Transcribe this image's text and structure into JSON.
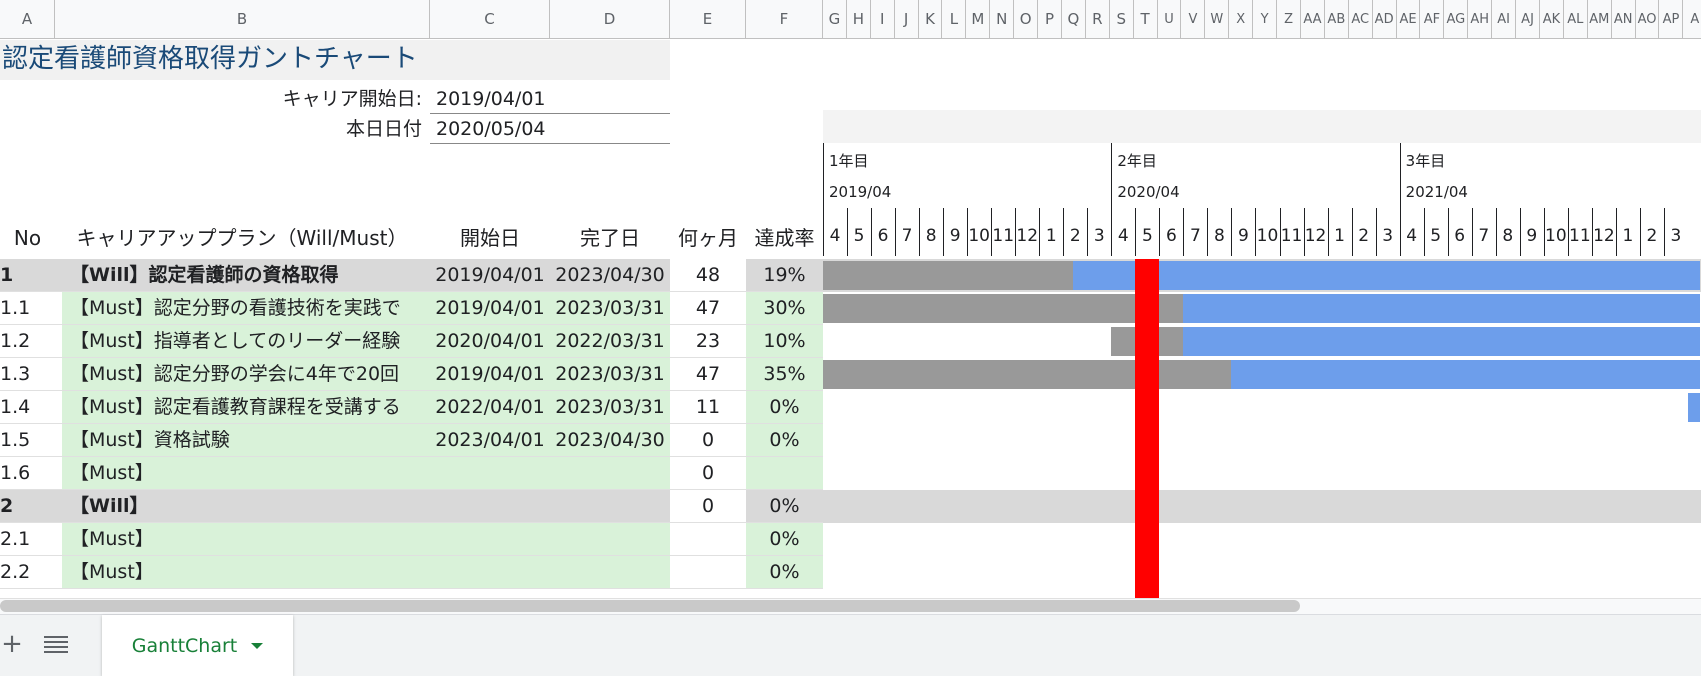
{
  "columns": [
    "A",
    "B",
    "C",
    "D",
    "E",
    "F",
    "G",
    "H",
    "I",
    "J",
    "K",
    "L",
    "M",
    "N",
    "O",
    "P",
    "Q",
    "R",
    "S",
    "T",
    "U",
    "V",
    "W",
    "X",
    "Y",
    "Z",
    "AA",
    "AB",
    "AC",
    "AD",
    "AE",
    "AF",
    "AG",
    "AH",
    "AI",
    "AJ",
    "AK",
    "AL",
    "AM",
    "AN",
    "AO",
    "AP",
    "A"
  ],
  "sheet_title": "認定看護師資格取得ガントチャート",
  "career_start": {
    "label": "キャリア開始日:",
    "value": "2019/04/01"
  },
  "today": {
    "label": "本日日付",
    "value": "2020/05/04"
  },
  "headers": {
    "no": "No",
    "plan": "キャリアアッププラン（Will/Must）",
    "start": "開始日",
    "end": "完了日",
    "months": "何ヶ月",
    "rate": "達成率"
  },
  "timeline": {
    "years": [
      {
        "label": "1年目",
        "month": "2019/04"
      },
      {
        "label": "2年目",
        "month": "2020/04"
      },
      {
        "label": "3年目",
        "month": "2021/04"
      }
    ],
    "months": [
      "4",
      "5",
      "6",
      "7",
      "8",
      "9",
      "10",
      "11",
      "12",
      "1",
      "2",
      "3",
      "4",
      "5",
      "6",
      "7",
      "8",
      "9",
      "10",
      "11",
      "12",
      "1",
      "2",
      "3",
      "4",
      "5",
      "6",
      "7",
      "8",
      "9",
      "10",
      "11",
      "12",
      "1",
      "2",
      "3"
    ],
    "today_month_index": 13
  },
  "rows": [
    {
      "no": "1",
      "plan": "【Will】認定看護師の資格取得",
      "start": "2019/04/01",
      "end": "2023/04/30",
      "months": "48",
      "rate": "19%",
      "type": "will",
      "bar_start": 0,
      "bar_done_end": 10.4
    },
    {
      "no": "1.1",
      "plan": "【Must】認定分野の看護技術を実践で",
      "start": "2019/04/01",
      "end": "2023/03/31",
      "months": "47",
      "rate": "30%",
      "type": "must",
      "bar_start": 0,
      "bar_done_end": 15.0
    },
    {
      "no": "1.2",
      "plan": "【Must】指導者としてのリーダー経験",
      "start": "2020/04/01",
      "end": "2022/03/31",
      "months": "23",
      "rate": "10%",
      "type": "must",
      "bar_start": 12,
      "bar_done_end": 15.0
    },
    {
      "no": "1.3",
      "plan": "【Must】認定分野の学会に4年で20回",
      "start": "2019/04/01",
      "end": "2023/03/31",
      "months": "47",
      "rate": "35%",
      "type": "must",
      "bar_start": 0,
      "bar_done_end": 17.0
    },
    {
      "no": "1.4",
      "plan": "【Must】認定看護教育課程を受講する",
      "start": "2022/04/01",
      "end": "2023/03/31",
      "months": "11",
      "rate": "0%",
      "type": "must",
      "bar_start": 36,
      "bar_done_end": 36
    },
    {
      "no": "1.5",
      "plan": "【Must】資格試験",
      "start": "2023/04/01",
      "end": "2023/04/30",
      "months": "0",
      "rate": "0%",
      "type": "must",
      "bar_start": null,
      "bar_done_end": null
    },
    {
      "no": "1.6",
      "plan": "【Must】",
      "start": "",
      "end": "",
      "months": "0",
      "rate": "",
      "type": "must",
      "bar_start": null,
      "bar_done_end": null
    },
    {
      "no": "2",
      "plan": "【Will】",
      "start": "",
      "end": "",
      "months": "0",
      "rate": "0%",
      "type": "will",
      "bar_start": null,
      "bar_done_end": null
    },
    {
      "no": "2.1",
      "plan": "【Must】",
      "start": "",
      "end": "",
      "months": "",
      "rate": "0%",
      "type": "must",
      "bar_start": null,
      "bar_done_end": null
    },
    {
      "no": "2.2",
      "plan": "【Must】",
      "start": "",
      "end": "",
      "months": "",
      "rate": "0%",
      "type": "must",
      "bar_start": null,
      "bar_done_end": null
    }
  ],
  "sheet_tab": {
    "name": "GanttChart",
    "add_icon": "plus-icon",
    "list_icon": "menu-lines-icon",
    "dropdown_icon": "caret-down-icon"
  },
  "colors": {
    "will_bg": "#d9d9d9",
    "must_bg": "#d9f2d9",
    "done": "#999999",
    "remaining": "#6d9eeb",
    "today": "#ff0000",
    "title": "#1a4a78"
  }
}
